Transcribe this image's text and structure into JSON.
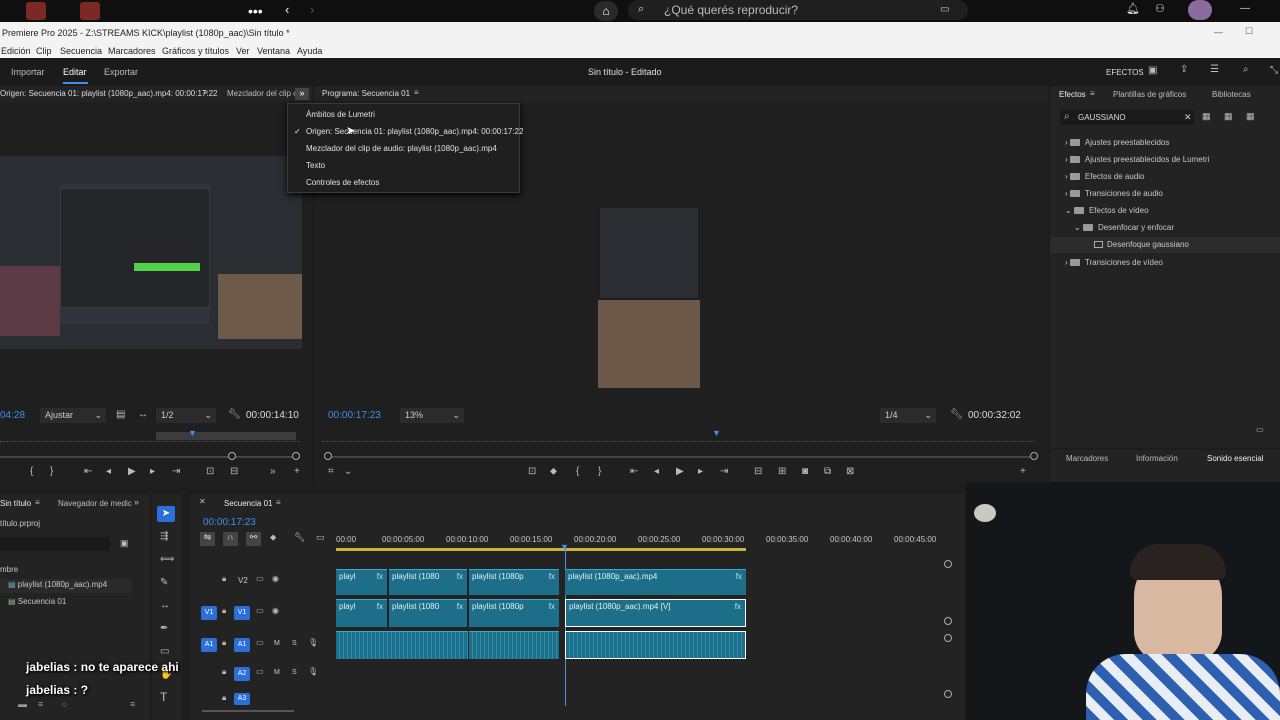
{
  "os_bar": {
    "search_placeholder": "¿Qué querés reproducir?"
  },
  "window": {
    "title": "Premiere Pro 2025 - Z:\\STREAMS KICK\\playlist (1080p_aac)\\Sin título *",
    "min": "—",
    "max": "☐",
    "close": "✕"
  },
  "menu": [
    "Edición",
    "Clip",
    "Secuencia",
    "Marcadores",
    "Gráficos y títulos",
    "Ver",
    "Ventana",
    "Ayuda"
  ],
  "workspace": {
    "tabs": [
      "Importar",
      "Editar",
      "Exportar"
    ],
    "active": "Editar",
    "project_title": "Sin título - Editado",
    "effects_label": "EFECTOS"
  },
  "source_panel": {
    "tab": "Origen: Secuencia 01: playlist (1080p_aac).mp4: 00:00:17:22",
    "tab2": "Mezclador del clip c",
    "timecode_left": "04:28",
    "fit": "Ajustar",
    "resolution": "1/2",
    "timecode_right": "00:00:14:10"
  },
  "program_panel": {
    "tab": "Programa: Secuencia 01",
    "timecode_left": "00:00:17:23",
    "zoom": "13%",
    "resolution": "1/4",
    "timecode_right": "00:00:32:02"
  },
  "dropdown_menu": {
    "items": [
      "Ámbitos de Lumetri",
      "Origen: Secuencia 01: playlist (1080p_aac).mp4: 00:00:17:22",
      "Mezclador del clip de audio: playlist (1080p_aac).mp4",
      "Texto",
      "Controles de efectos"
    ],
    "checked_index": 1,
    "check": "✓"
  },
  "effects_panel": {
    "tabs": [
      "Efectos",
      "Plantillas de gráficos",
      "Bibliotecas"
    ],
    "search_value": "GAUSSIANO",
    "tree": [
      {
        "label": "Ajustes preestablecidos",
        "level": 0,
        "open": false
      },
      {
        "label": "Ajustes preestablecidos de Lumetri",
        "level": 0,
        "open": false
      },
      {
        "label": "Efectos de audio",
        "level": 0,
        "open": false
      },
      {
        "label": "Transiciones de audio",
        "level": 0,
        "open": false
      },
      {
        "label": "Efectos de vídeo",
        "level": 0,
        "open": true
      },
      {
        "label": "Desenfocar y enfocar",
        "level": 1,
        "open": true
      },
      {
        "label": "Desenfoque gaussiano",
        "level": 2,
        "open": false
      },
      {
        "label": "Transiciones de vídeo",
        "level": 0,
        "open": false
      }
    ],
    "bottom_tabs": [
      "Marcadores",
      "Información",
      "Sonido esencial"
    ]
  },
  "project_panel": {
    "tab": "Sin título",
    "tab2": "Navegador de medic",
    "file": "título.prproj",
    "column": "mbre",
    "items": [
      "playlist (1080p_aac).mp4",
      "Secuencia 01"
    ]
  },
  "timeline": {
    "tab": "Secuencia 01",
    "timecode": "00:00:17:23",
    "ruler": [
      "00:00",
      "00:00:05:00",
      "00:00:10:00",
      "00:00:15:00",
      "00:00:20:00",
      "00:00:25:00",
      "00:00:30:00",
      "00:00:35:00",
      "00:00:40:00",
      "00:00:45:00"
    ],
    "tracks": {
      "v2": {
        "src": "",
        "dst": "V2"
      },
      "v1": {
        "src": "V1",
        "dst": "V1"
      },
      "a1": {
        "src": "A1",
        "dst": "A1"
      },
      "a2": {
        "dst": "A2"
      },
      "a3": {
        "dst": "A3"
      },
      "mute": "M",
      "solo": "S"
    },
    "v2_clips": [
      "playl",
      "playlist (1080",
      "playlist (1080p",
      "playlist (1080p_aac).mp4"
    ],
    "v1_clips": [
      "playl",
      "playlist (1080",
      "playlist (1080p",
      "playlist (1080p_aac).mp4 [V]"
    ],
    "fx": "fx"
  },
  "chat": [
    {
      "user": "jabelias",
      "message": ": no te aparece ahi"
    },
    {
      "user": "jabelias",
      "message": ": ?"
    }
  ],
  "icons": {
    "home": "home-icon",
    "search": "search-icon",
    "bell": "bell-icon",
    "gear": "gear-icon",
    "wrench": "wrench-icon",
    "play": "play-icon"
  },
  "colors": {
    "accent": "#3e8ff0",
    "clip": "#1d6f89",
    "playhead": "#4a90e2"
  }
}
